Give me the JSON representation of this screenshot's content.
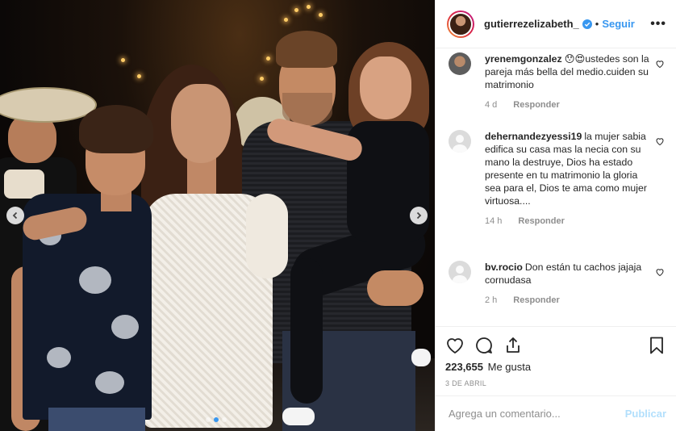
{
  "post": {
    "image_description_icon": "photo",
    "carousel": {
      "prev_icon": "chevron-left-icon",
      "next_icon": "chevron-right-icon",
      "dots": 3,
      "active_dot": 1
    }
  },
  "header": {
    "username": "gutierrezelizabeth_",
    "separator": "•",
    "follow_label": "Seguir",
    "more_label": "•••"
  },
  "comments": [
    {
      "user": "yrenemgonzalez",
      "text": "😯😍ustedes son la pareja más bella del medio.cuiden su matrimonio",
      "time": "4 d",
      "reply": "Responder"
    },
    {
      "user": "dehernandezyessi19",
      "text": "la mujer sabia edifica su casa mas la necia con su mano la destruye, Dios ha estado presente en tu matrimonio la gloria sea para el, Dios te ama como mujer virtuosa....",
      "time": "14 h",
      "reply": "Responder"
    },
    {
      "user": "bv.rocio",
      "text": "Don están tu cachos jajaja cornudasa",
      "time": "2 h",
      "reply": "Responder"
    }
  ],
  "actions": {
    "likes_count": "223,655",
    "likes_word": "Me gusta",
    "date": "3 DE ABRIL"
  },
  "add_comment": {
    "placeholder": "Agrega un comentario...",
    "publish_label": "Publicar"
  },
  "colors": {
    "accent": "#3897f0",
    "publish_disabled": "#b2dffc",
    "meta": "#8e8e8e",
    "text": "#262626"
  }
}
